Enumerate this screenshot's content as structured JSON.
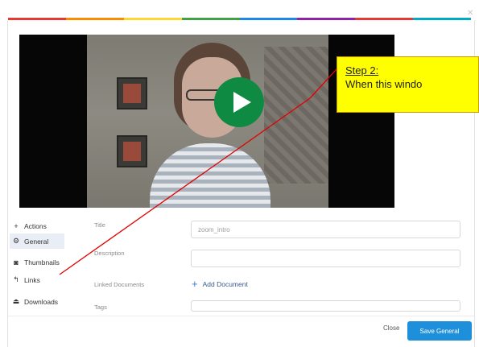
{
  "colors": {
    "accent_bar": [
      "#e53935",
      "#fb8c00",
      "#fdd835",
      "#43a047",
      "#1e88e5",
      "#8e24aa",
      "#e53935",
      "#00acc1"
    ],
    "play_button": "#0f8a43",
    "callout_fill": "#ffff00",
    "save_button": "#1e8fdb",
    "annotation_line": "#e00000"
  },
  "video": {
    "play_icon": "play-icon"
  },
  "callout": {
    "step": "Step 2:",
    "text": "When this windo"
  },
  "sidebar": {
    "items": [
      {
        "icon": "plus-icon",
        "glyph": "+",
        "label": "Actions"
      },
      {
        "icon": "gear-icon",
        "glyph": "⚙",
        "label": "General"
      },
      {
        "icon": "camera-icon",
        "glyph": "◙",
        "label": "Thumbnails"
      },
      {
        "icon": "link-arrow-icon",
        "glyph": "↰",
        "label": "Links"
      },
      {
        "icon": "download-icon",
        "glyph": "⏏",
        "label": "Downloads"
      }
    ]
  },
  "form": {
    "title_label": "Title",
    "title_value": "zoom_intro",
    "description_label": "Description",
    "linked_label": "Linked Documents",
    "add_document": "Add Document",
    "tags_label": "Tags"
  },
  "footer": {
    "close": "Close",
    "save": "Save General"
  }
}
